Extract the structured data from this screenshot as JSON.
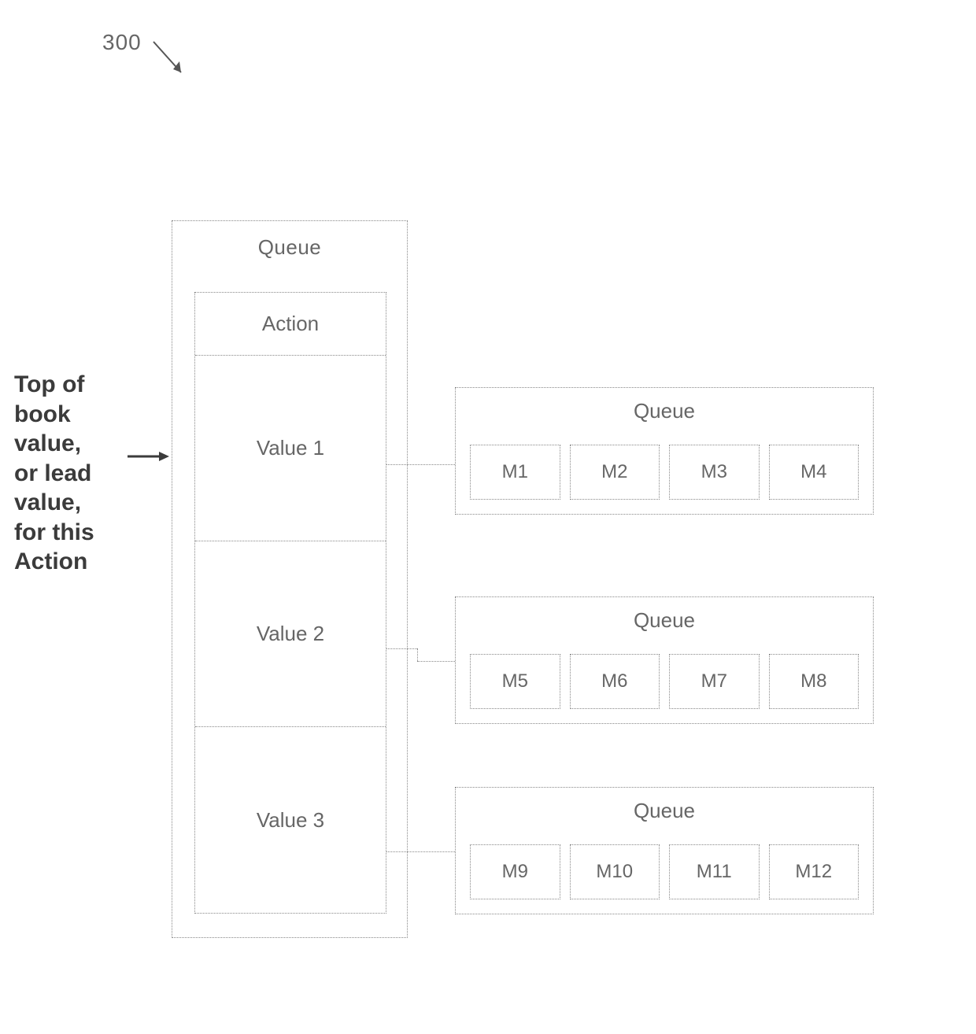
{
  "ref": {
    "number": "300"
  },
  "sideLabel": {
    "line1": "Top of",
    "line2": "book",
    "line3": "value,",
    "line4": "or lead",
    "line5": "value,",
    "line6": "for this",
    "line7": "Action"
  },
  "mainQueue": {
    "title": "Queue",
    "actionLabel": "Action",
    "values": {
      "v1": "Value 1",
      "v2": "Value 2",
      "v3": "Value 3"
    }
  },
  "subQueues": {
    "title": "Queue",
    "q1": {
      "i0": "M1",
      "i1": "M2",
      "i2": "M3",
      "i3": "M4"
    },
    "q2": {
      "i0": "M5",
      "i1": "M6",
      "i2": "M7",
      "i3": "M8"
    },
    "q3": {
      "i0": "M9",
      "i1": "M10",
      "i2": "M11",
      "i3": "M12"
    }
  }
}
